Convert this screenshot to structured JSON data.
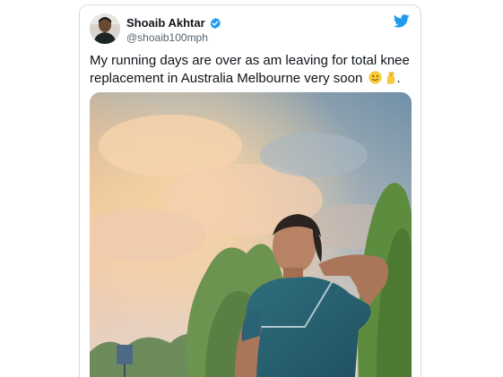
{
  "tweet": {
    "author": {
      "display_name": "Shoaib Akhtar",
      "handle": "@shoaib100mph",
      "verified": true,
      "verified_color": "#1d9bf0"
    },
    "text_lines": [
      "My running days are over as am leaving for total knee",
      "replacement in Australia Melbourne very soon"
    ],
    "text_end_punctuation": ".",
    "emojis": [
      "smiling-face-with-tear-icon",
      "crossed-fingers-icon"
    ],
    "brand_icon": "twitter-bird-icon",
    "brand_color": "#1d9bf0",
    "media": {
      "kind": "photo"
    }
  }
}
